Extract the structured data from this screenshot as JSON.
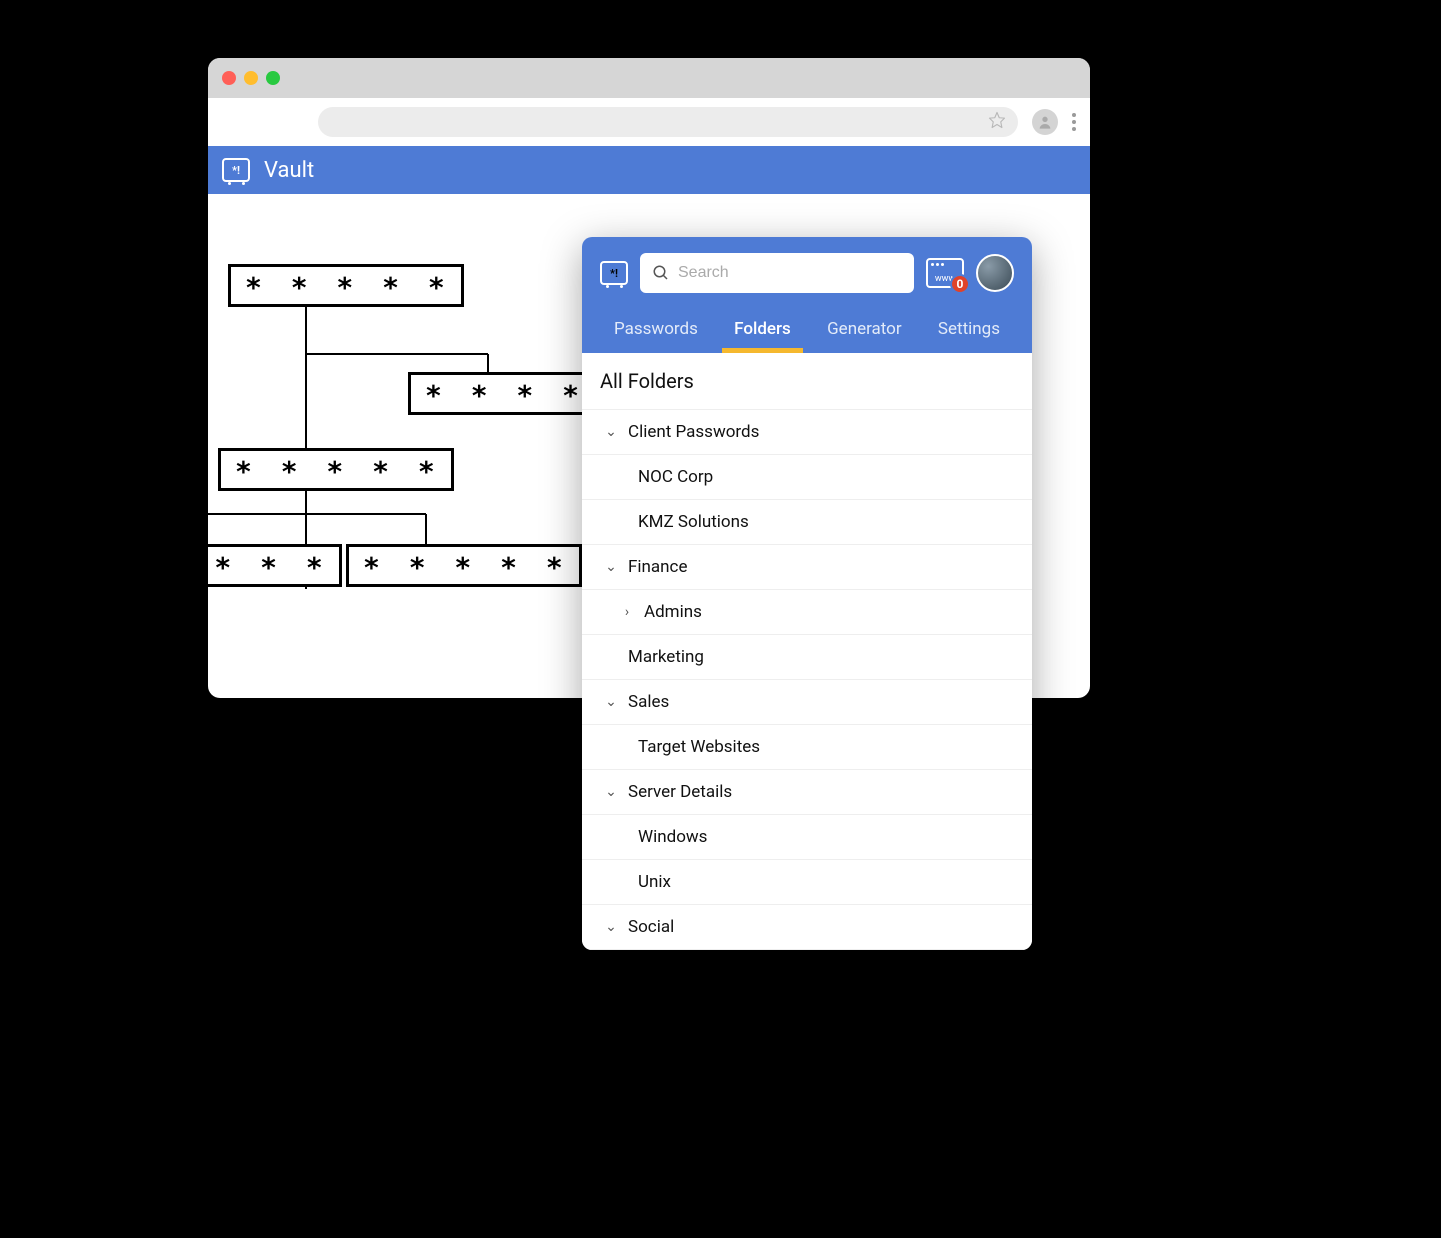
{
  "browser": {
    "app_title": "Vault"
  },
  "diagram": {
    "mask": "* * * * *"
  },
  "popup": {
    "search_placeholder": "Search",
    "www_label": "www",
    "badge_count": "0",
    "tabs": {
      "passwords": "Passwords",
      "folders": "Folders",
      "generator": "Generator",
      "settings": "Settings"
    },
    "folders_title": "All Folders",
    "tree": {
      "client_passwords": "Client Passwords",
      "noc_corp": "NOC Corp",
      "kmz_solutions": "KMZ Solutions",
      "finance": "Finance",
      "admins": "Admins",
      "marketing": "Marketing",
      "sales": "Sales",
      "target_websites": "Target Websites",
      "server_details": "Server Details",
      "windows": "Windows",
      "unix": "Unix",
      "social": "Social"
    }
  }
}
